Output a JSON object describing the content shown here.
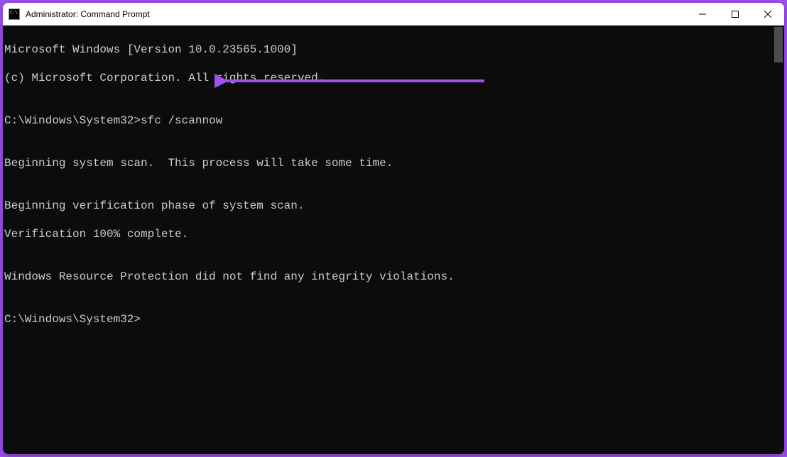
{
  "window": {
    "title": "Administrator: Command Prompt"
  },
  "terminal": {
    "line1": "Microsoft Windows [Version 10.0.23565.1000]",
    "line2": "(c) Microsoft Corporation. All rights reserved.",
    "blank1": "",
    "prompt1_path": "C:\\Windows\\System32>",
    "prompt1_cmd": "sfc /scannow",
    "blank2": "",
    "line3": "Beginning system scan.  This process will take some time.",
    "blank3": "",
    "line4": "Beginning verification phase of system scan.",
    "line5": "Verification 100% complete.",
    "blank4": "",
    "line6": "Windows Resource Protection did not find any integrity violations.",
    "blank5": "",
    "prompt2_path": "C:\\Windows\\System32>"
  },
  "annotation": {
    "color": "#a050f0"
  }
}
